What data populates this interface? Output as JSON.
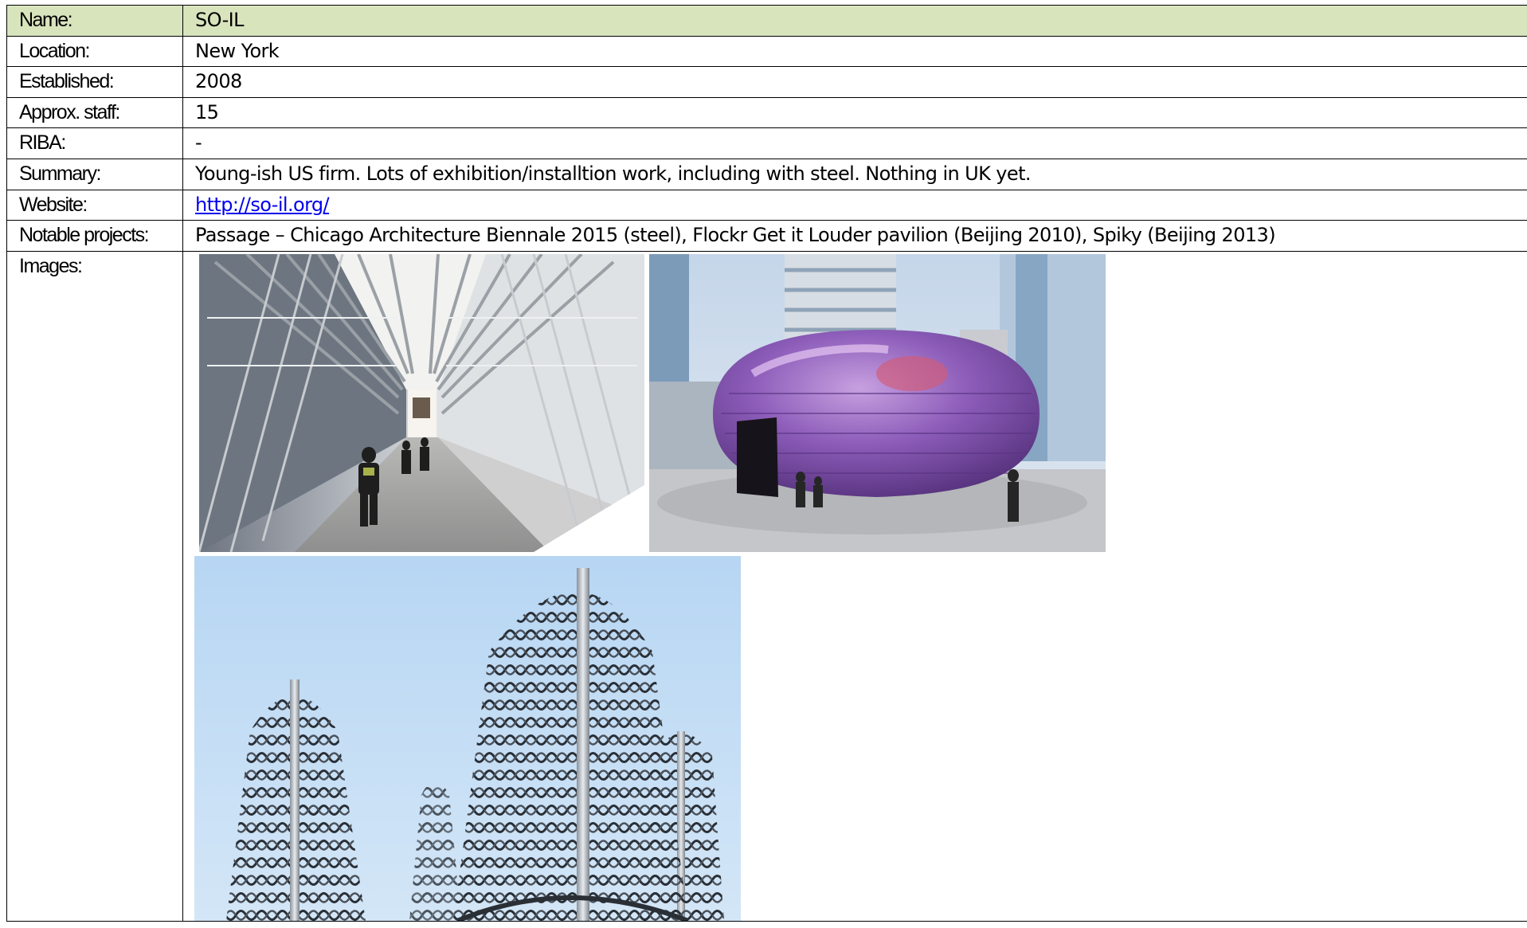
{
  "rows": [
    {
      "label": "Name:",
      "value": "SO-IL"
    },
    {
      "label": "Location:",
      "value": "New York"
    },
    {
      "label": "Established:",
      "value": "2008"
    },
    {
      "label": "Approx. staff:",
      "value": "15"
    },
    {
      "label": "RIBA:",
      "value": "-"
    },
    {
      "label": "Summary:",
      "value": "Young-ish US firm. Lots of exhibition/installtion work, including with steel. Nothing in UK yet."
    },
    {
      "label": "Website:",
      "value": "http://so-il.org/"
    },
    {
      "label": "Notable projects:",
      "value": "Passage – Chicago Architecture Biennale 2015 (steel), Flockr Get it Louder pavilion (Beijing 2010), Spiky (Beijing 2013)"
    }
  ],
  "images_label": "Images:",
  "header_color": "#d8e4bc",
  "link_color": "#0000ee"
}
